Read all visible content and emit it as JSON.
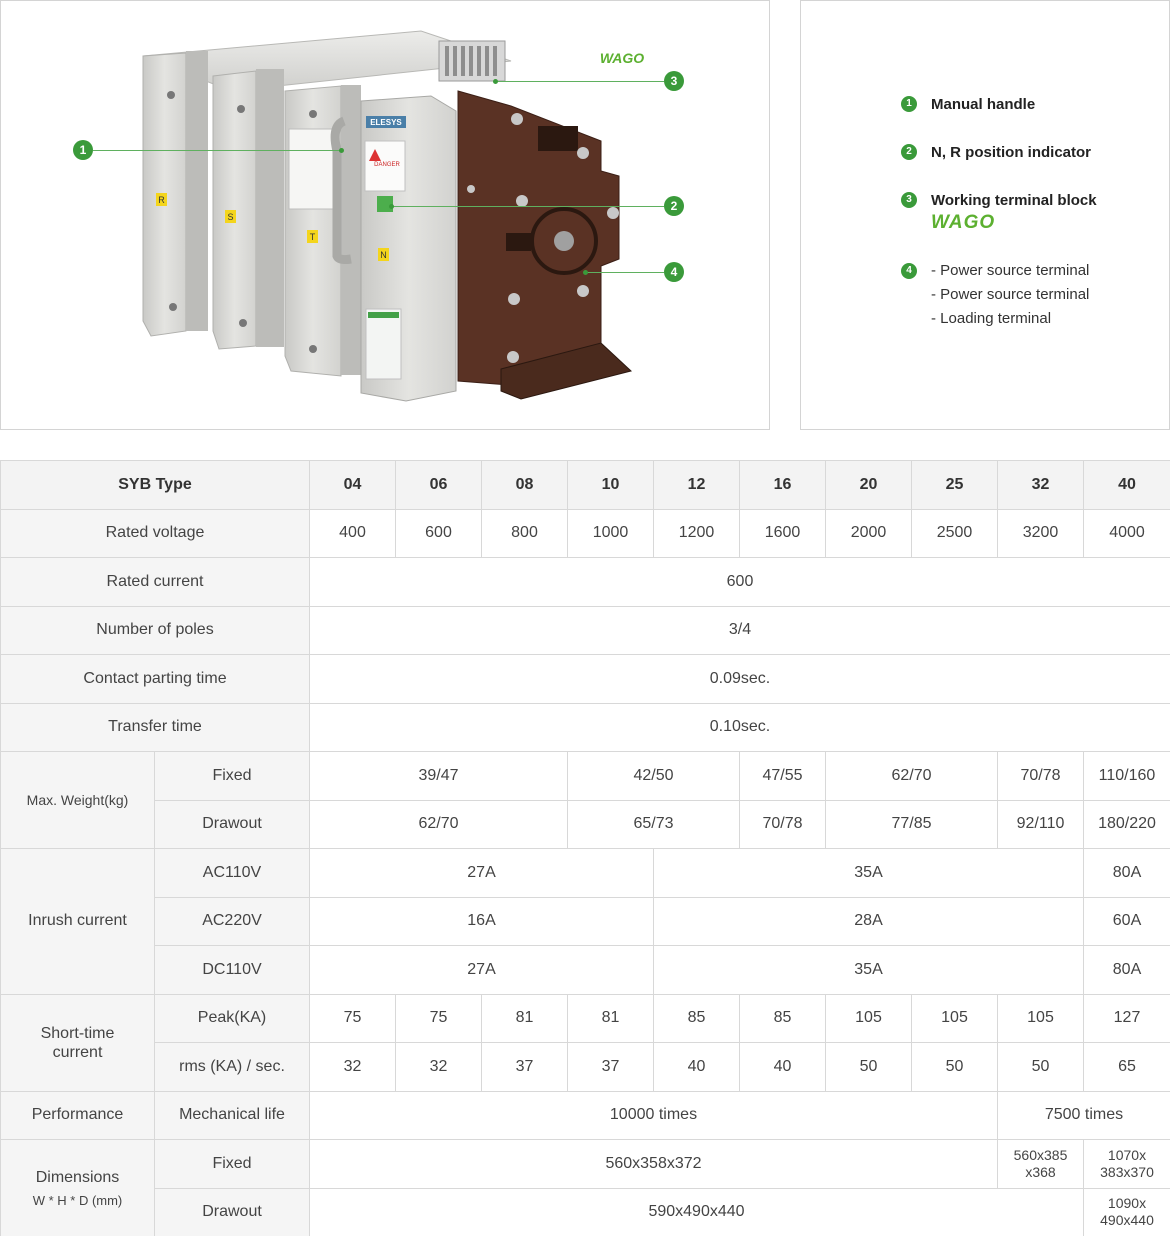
{
  "brand": {
    "logo_text": "WAGO",
    "accent": "#3a9a3a"
  },
  "product": {
    "device_labels": {
      "phase_r": "R",
      "phase_s": "S",
      "phase_t": "T",
      "phase_n": "N",
      "badge": "ELESYS",
      "danger": "DANGER"
    },
    "callouts": [
      "1",
      "2",
      "3",
      "4"
    ]
  },
  "legend": {
    "items": [
      {
        "num": "1",
        "label": "Manual handle"
      },
      {
        "num": "2",
        "label": "N, R position indicator"
      },
      {
        "num": "3",
        "label": "Working terminal block",
        "logo": "WAGO"
      },
      {
        "num": "4",
        "lines": [
          "- Power source terminal",
          "- Power source terminal",
          "- Loading terminal"
        ]
      }
    ]
  },
  "table": {
    "header_label": "SYB Type",
    "types": [
      "04",
      "06",
      "08",
      "10",
      "12",
      "16",
      "20",
      "25",
      "32",
      "40"
    ],
    "rated_voltage": {
      "label": "Rated voltage",
      "values": [
        "400",
        "600",
        "800",
        "1000",
        "1200",
        "1600",
        "2000",
        "2500",
        "3200",
        "4000"
      ]
    },
    "rated_current": {
      "label": "Rated current",
      "value": "600"
    },
    "poles": {
      "label": "Number of poles",
      "value": "3/4"
    },
    "contact_parting": {
      "label": "Contact parting time",
      "value": "0.09sec."
    },
    "transfer": {
      "label": "Transfer time",
      "value": "0.10sec."
    },
    "weight": {
      "label": "Max. Weight(kg)",
      "fixed_label": "Fixed",
      "drawout_label": "Drawout",
      "fixed": [
        "39/47",
        "42/50",
        "47/55",
        "62/70",
        "70/78",
        "110/160"
      ],
      "drawout": [
        "62/70",
        "65/73",
        "70/78",
        "77/85",
        "92/110",
        "180/220"
      ]
    },
    "inrush": {
      "label": "Inrush current",
      "rows": [
        {
          "label": "AC110V",
          "values": [
            "27A",
            "35A",
            "80A"
          ]
        },
        {
          "label": "AC220V",
          "values": [
            "16A",
            "28A",
            "60A"
          ]
        },
        {
          "label": "DC110V",
          "values": [
            "27A",
            "35A",
            "80A"
          ]
        }
      ]
    },
    "short_time": {
      "label_line1": "Short-time",
      "label_line2": "current",
      "peak_label": "Peak(KA)",
      "rms_label": "rms (KA) / sec.",
      "peak": [
        "75",
        "75",
        "81",
        "81",
        "85",
        "85",
        "105",
        "105",
        "105",
        "127"
      ],
      "rms": [
        "32",
        "32",
        "37",
        "37",
        "40",
        "40",
        "50",
        "50",
        "50",
        "65"
      ]
    },
    "performance": {
      "label": "Performance",
      "sub_label": "Mechanical life",
      "values": [
        "10000 times",
        "7500 times"
      ]
    },
    "dimensions": {
      "label": "Dimensions",
      "sub": "W * H * D (mm)",
      "fixed_label": "Fixed",
      "drawout_label": "Drawout",
      "fixed": [
        "560x358x372",
        "560x385",
        "x368",
        "1070x",
        "383x370"
      ],
      "drawout": [
        "590x490x440",
        "1090x",
        "490x440"
      ]
    }
  }
}
